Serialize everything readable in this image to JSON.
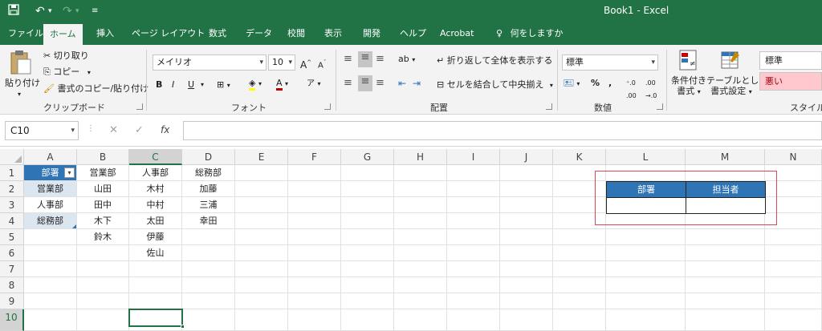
{
  "app": {
    "window_title": "Book1  -  Excel"
  },
  "tabs": [
    "ファイル",
    "ホーム",
    "挿入",
    "ページ レイアウト",
    "数式",
    "データ",
    "校閲",
    "表示",
    "開発",
    "ヘルプ",
    "Acrobat",
    "何をしますか"
  ],
  "active_tab": "ホーム",
  "ribbon": {
    "clipboard": {
      "paste": "貼り付け",
      "cut": "切り取り",
      "copy": "コピー",
      "format_painter": "書式のコピー/貼り付け",
      "label": "クリップボード"
    },
    "font": {
      "font_name": "メイリオ",
      "font_size": "10",
      "label": "フォント"
    },
    "alignment": {
      "wrap_text": "折り返して全体を表示する",
      "merge_center": "セルを結合して中央揃え",
      "label": "配置"
    },
    "number": {
      "format": "標準",
      "label": "数値"
    },
    "styles": {
      "conditional": "条件付き",
      "conditional2": "書式",
      "table": "テーブルとして",
      "table2": "書式設定",
      "style_normal": "標準",
      "style_bad": "悪い",
      "label": "スタイル"
    }
  },
  "formula_bar": {
    "name_box": "C10",
    "fx": "fx",
    "formula": ""
  },
  "grid": {
    "columns": [
      "A",
      "B",
      "C",
      "D",
      "E",
      "F",
      "G",
      "H",
      "I",
      "J",
      "K",
      "L",
      "M",
      "N"
    ],
    "rows": [
      "1",
      "2",
      "3",
      "4",
      "5",
      "6",
      "7",
      "8",
      "9",
      "10"
    ],
    "cells": {
      "A1": "部署",
      "A2": "営業部",
      "A3": "人事部",
      "A4": "総務部",
      "B1": "営業部",
      "B2": "山田",
      "B3": "田中",
      "B4": "木下",
      "B5": "鈴木",
      "C1": "人事部",
      "C2": "木村",
      "C3": "中村",
      "C4": "太田",
      "C5": "伊藤",
      "C6": "佐山",
      "D1": "総務部",
      "D2": "加藤",
      "D3": "三浦",
      "D4": "幸田",
      "L2": "部署",
      "M2": "担当者"
    },
    "selected_cell": "C10"
  },
  "colors": {
    "excel_green": "#217346",
    "table_header_blue": "#2f75b5",
    "highlight_red": "#e0464f"
  }
}
